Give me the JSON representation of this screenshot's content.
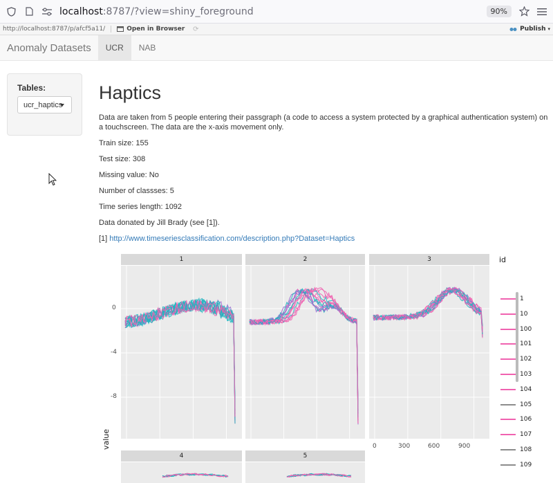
{
  "browser": {
    "url_host": "localhost",
    "url_path": ":8787/?view=shiny_foreground",
    "zoom": "90%"
  },
  "rstudio": {
    "address": "http://localhost:8787/p/afcf5a11/",
    "open_in_browser": "Open in Browser",
    "publish": "Publish"
  },
  "navbar": {
    "brand": "Anomaly Datasets",
    "tabs": [
      {
        "label": "UCR",
        "active": true
      },
      {
        "label": "NAB",
        "active": false
      }
    ]
  },
  "sidebar": {
    "tables_label": "Tables:",
    "selected": "ucr_haptics"
  },
  "main": {
    "title": "Haptics",
    "description": "Data are taken from 5 people entering their passgraph (a code to access a system protected by a graphical authentication system) on a touchscreen. The data are the x-axis movement only.",
    "train_size": "Train size: 155",
    "test_size": "Test size: 308",
    "missing_value": "Missing value: No",
    "num_classes": "Number of classses: 5",
    "ts_length": "Time series length: 1092",
    "donated": "Data donated by Jill Brady (see [1]).",
    "ref_prefix": "[1] ",
    "ref_link": "http://www.timeseriesclassification.com/description.php?Dataset=Haptics"
  },
  "plot": {
    "facets": [
      "1",
      "2",
      "3",
      "4",
      "5"
    ],
    "y_ticks": [
      "0",
      "-4",
      "-8"
    ],
    "x_ticks": [
      "0",
      "300",
      "600",
      "900"
    ],
    "ylabel": "value",
    "legend_title": "id",
    "legend_items": [
      "1",
      "10",
      "100",
      "101",
      "102",
      "103",
      "104",
      "105",
      "106",
      "107",
      "108",
      "109"
    ],
    "colors": {
      "teal": "#1fb5c0",
      "pink": "#f062b0",
      "purple": "#9a6bd0",
      "gray": "#8c8c8c"
    }
  }
}
